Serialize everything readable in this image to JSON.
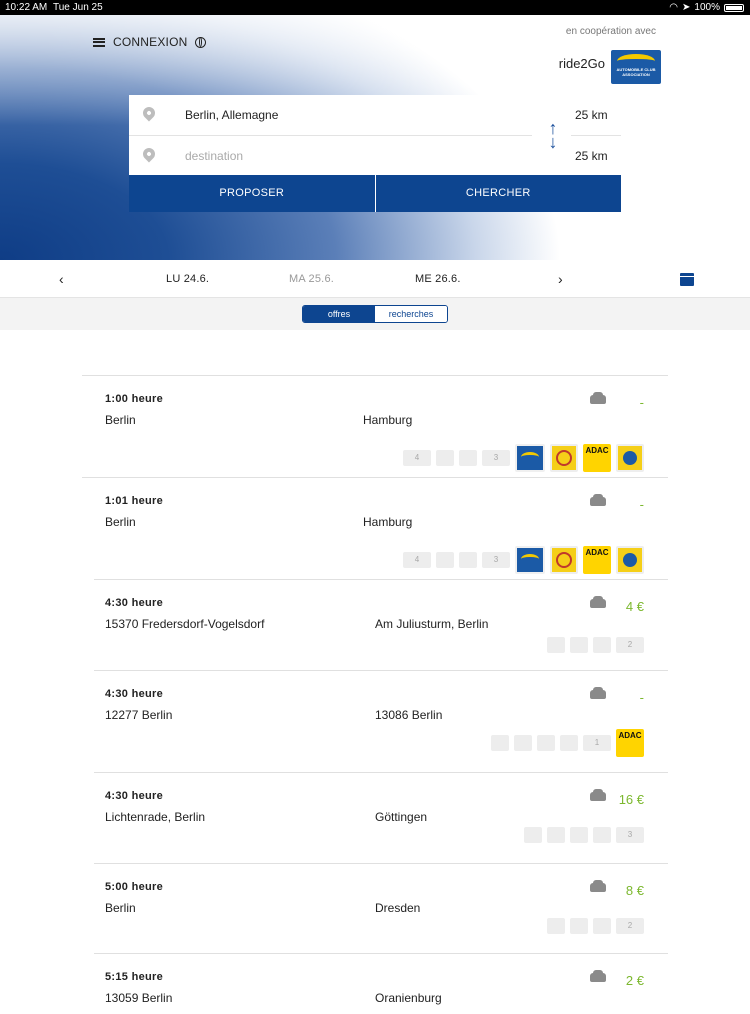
{
  "statusbar": {
    "time": "10:22 AM",
    "date": "Tue Jun 25",
    "battery": "100%"
  },
  "header": {
    "menu_label": "CONNEXION",
    "coop_text": "en coopération avec",
    "brand": "ride2Go",
    "partner_logo_text": "AUTOMOBILE CLUB ASSOCIATION"
  },
  "search": {
    "origin": "Berlin, Allemagne",
    "destination_placeholder": "destination",
    "origin_radius": "25 km",
    "destination_radius": "25 km",
    "propose_label": "PROPOSER",
    "search_label": "CHERCHER"
  },
  "datebar": {
    "days": [
      "LU 24.6.",
      "MA 25.6.",
      "ME 26.6."
    ],
    "prev": "‹",
    "next": "›"
  },
  "tabs": {
    "offers": "offres",
    "searches": "recherches",
    "active": "offres"
  },
  "rides": [
    {
      "time": "1:00 heure",
      "from": "Berlin",
      "to": "Hamburg",
      "price": "-",
      "features": [
        "4",
        "",
        "",
        "3"
      ],
      "partners": [
        "aca",
        "round",
        "ADAC",
        "tcs"
      ]
    },
    {
      "time": "1:01 heure",
      "from": "Berlin",
      "to": "Hamburg",
      "price": "-",
      "features": [
        "4",
        "",
        "",
        "3"
      ],
      "partners": [
        "aca",
        "round",
        "ADAC",
        "tcs"
      ]
    },
    {
      "time": "4:30 heure",
      "from": "15370 Fredersdorf-Vogelsdorf",
      "to": "Am Juliusturm, Berlin",
      "price": "4 €",
      "features": [
        "",
        "",
        "",
        "2"
      ],
      "partners": []
    },
    {
      "time": "4:30 heure",
      "from": "12277 Berlin",
      "to": "13086 Berlin",
      "price": "-",
      "features": [
        "",
        "",
        "",
        "",
        "1"
      ],
      "partners": [
        "ADAC"
      ]
    },
    {
      "time": "4:30 heure",
      "from": "Lichtenrade, Berlin",
      "to": "Göttingen",
      "price": "16 €",
      "features": [
        "",
        "",
        "",
        "",
        "3"
      ],
      "partners": []
    },
    {
      "time": "5:00 heure",
      "from": "Berlin",
      "to": "Dresden",
      "price": "8 €",
      "features": [
        "",
        "",
        "",
        "2"
      ],
      "partners": []
    },
    {
      "time": "5:15 heure",
      "from": "13059 Berlin",
      "to": "Oranienburg",
      "price": "2 €",
      "features": [],
      "partners": []
    }
  ],
  "colors": {
    "primary": "#0d4590",
    "price": "#7cb82f",
    "adac_yellow": "#ffd400"
  }
}
